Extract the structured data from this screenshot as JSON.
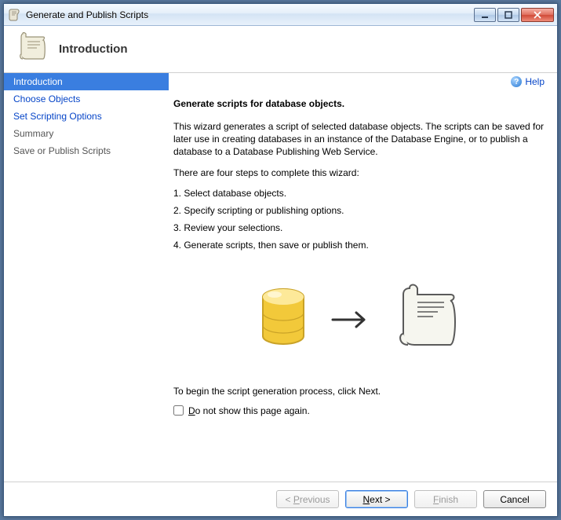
{
  "window": {
    "title": "Generate and Publish Scripts"
  },
  "header": {
    "title": "Introduction"
  },
  "sidebar": {
    "items": [
      {
        "label": "Introduction",
        "active": true
      },
      {
        "label": "Choose Objects"
      },
      {
        "label": "Set Scripting Options"
      },
      {
        "label": "Summary",
        "muted": true
      },
      {
        "label": "Save or Publish Scripts",
        "muted": true
      }
    ]
  },
  "help": {
    "label": "Help"
  },
  "content": {
    "heading": "Generate scripts for database objects.",
    "intro": "This wizard generates a script of selected database objects. The scripts can be saved for later use in creating databases in an instance of the Database Engine, or to publish a database to a Database Publishing Web Service.",
    "steps_lead": "There are four steps to complete this wizard:",
    "steps": [
      "1. Select database objects.",
      "2. Specify scripting or publishing options.",
      "3. Review your selections.",
      "4. Generate scripts, then save or publish them."
    ],
    "begin_note": "To begin the script generation process, click Next.",
    "checkbox_label": "Do not show this page again."
  },
  "buttons": {
    "previous": "< Previous",
    "next": "Next >",
    "finish": "Finish",
    "cancel": "Cancel"
  }
}
